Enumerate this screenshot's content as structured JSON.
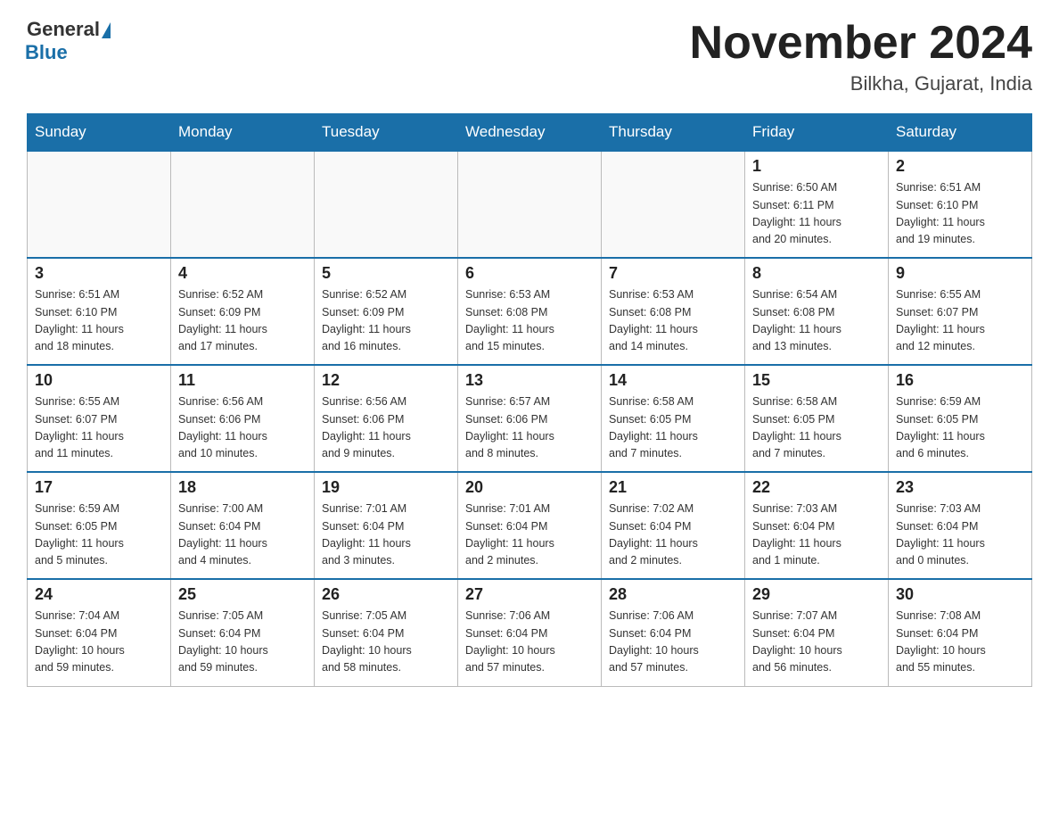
{
  "logo": {
    "general": "General",
    "blue": "Blue"
  },
  "header": {
    "month": "November 2024",
    "location": "Bilkha, Gujarat, India"
  },
  "days_of_week": [
    "Sunday",
    "Monday",
    "Tuesday",
    "Wednesday",
    "Thursday",
    "Friday",
    "Saturday"
  ],
  "weeks": [
    [
      {
        "day": "",
        "info": ""
      },
      {
        "day": "",
        "info": ""
      },
      {
        "day": "",
        "info": ""
      },
      {
        "day": "",
        "info": ""
      },
      {
        "day": "",
        "info": ""
      },
      {
        "day": "1",
        "info": "Sunrise: 6:50 AM\nSunset: 6:11 PM\nDaylight: 11 hours\nand 20 minutes."
      },
      {
        "day": "2",
        "info": "Sunrise: 6:51 AM\nSunset: 6:10 PM\nDaylight: 11 hours\nand 19 minutes."
      }
    ],
    [
      {
        "day": "3",
        "info": "Sunrise: 6:51 AM\nSunset: 6:10 PM\nDaylight: 11 hours\nand 18 minutes."
      },
      {
        "day": "4",
        "info": "Sunrise: 6:52 AM\nSunset: 6:09 PM\nDaylight: 11 hours\nand 17 minutes."
      },
      {
        "day": "5",
        "info": "Sunrise: 6:52 AM\nSunset: 6:09 PM\nDaylight: 11 hours\nand 16 minutes."
      },
      {
        "day": "6",
        "info": "Sunrise: 6:53 AM\nSunset: 6:08 PM\nDaylight: 11 hours\nand 15 minutes."
      },
      {
        "day": "7",
        "info": "Sunrise: 6:53 AM\nSunset: 6:08 PM\nDaylight: 11 hours\nand 14 minutes."
      },
      {
        "day": "8",
        "info": "Sunrise: 6:54 AM\nSunset: 6:08 PM\nDaylight: 11 hours\nand 13 minutes."
      },
      {
        "day": "9",
        "info": "Sunrise: 6:55 AM\nSunset: 6:07 PM\nDaylight: 11 hours\nand 12 minutes."
      }
    ],
    [
      {
        "day": "10",
        "info": "Sunrise: 6:55 AM\nSunset: 6:07 PM\nDaylight: 11 hours\nand 11 minutes."
      },
      {
        "day": "11",
        "info": "Sunrise: 6:56 AM\nSunset: 6:06 PM\nDaylight: 11 hours\nand 10 minutes."
      },
      {
        "day": "12",
        "info": "Sunrise: 6:56 AM\nSunset: 6:06 PM\nDaylight: 11 hours\nand 9 minutes."
      },
      {
        "day": "13",
        "info": "Sunrise: 6:57 AM\nSunset: 6:06 PM\nDaylight: 11 hours\nand 8 minutes."
      },
      {
        "day": "14",
        "info": "Sunrise: 6:58 AM\nSunset: 6:05 PM\nDaylight: 11 hours\nand 7 minutes."
      },
      {
        "day": "15",
        "info": "Sunrise: 6:58 AM\nSunset: 6:05 PM\nDaylight: 11 hours\nand 7 minutes."
      },
      {
        "day": "16",
        "info": "Sunrise: 6:59 AM\nSunset: 6:05 PM\nDaylight: 11 hours\nand 6 minutes."
      }
    ],
    [
      {
        "day": "17",
        "info": "Sunrise: 6:59 AM\nSunset: 6:05 PM\nDaylight: 11 hours\nand 5 minutes."
      },
      {
        "day": "18",
        "info": "Sunrise: 7:00 AM\nSunset: 6:04 PM\nDaylight: 11 hours\nand 4 minutes."
      },
      {
        "day": "19",
        "info": "Sunrise: 7:01 AM\nSunset: 6:04 PM\nDaylight: 11 hours\nand 3 minutes."
      },
      {
        "day": "20",
        "info": "Sunrise: 7:01 AM\nSunset: 6:04 PM\nDaylight: 11 hours\nand 2 minutes."
      },
      {
        "day": "21",
        "info": "Sunrise: 7:02 AM\nSunset: 6:04 PM\nDaylight: 11 hours\nand 2 minutes."
      },
      {
        "day": "22",
        "info": "Sunrise: 7:03 AM\nSunset: 6:04 PM\nDaylight: 11 hours\nand 1 minute."
      },
      {
        "day": "23",
        "info": "Sunrise: 7:03 AM\nSunset: 6:04 PM\nDaylight: 11 hours\nand 0 minutes."
      }
    ],
    [
      {
        "day": "24",
        "info": "Sunrise: 7:04 AM\nSunset: 6:04 PM\nDaylight: 10 hours\nand 59 minutes."
      },
      {
        "day": "25",
        "info": "Sunrise: 7:05 AM\nSunset: 6:04 PM\nDaylight: 10 hours\nand 59 minutes."
      },
      {
        "day": "26",
        "info": "Sunrise: 7:05 AM\nSunset: 6:04 PM\nDaylight: 10 hours\nand 58 minutes."
      },
      {
        "day": "27",
        "info": "Sunrise: 7:06 AM\nSunset: 6:04 PM\nDaylight: 10 hours\nand 57 minutes."
      },
      {
        "day": "28",
        "info": "Sunrise: 7:06 AM\nSunset: 6:04 PM\nDaylight: 10 hours\nand 57 minutes."
      },
      {
        "day": "29",
        "info": "Sunrise: 7:07 AM\nSunset: 6:04 PM\nDaylight: 10 hours\nand 56 minutes."
      },
      {
        "day": "30",
        "info": "Sunrise: 7:08 AM\nSunset: 6:04 PM\nDaylight: 10 hours\nand 55 minutes."
      }
    ]
  ]
}
